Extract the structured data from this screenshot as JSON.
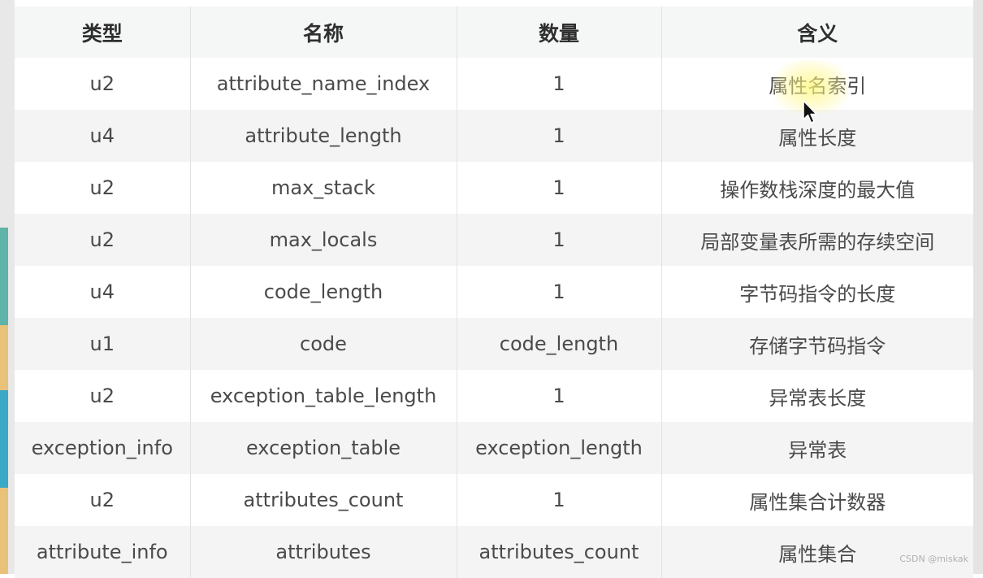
{
  "table": {
    "headers": [
      "类型",
      "名称",
      "数量",
      "含义"
    ],
    "rows": [
      [
        "u2",
        "attribute_name_index",
        "1",
        "属性名索引"
      ],
      [
        "u4",
        "attribute_length",
        "1",
        "属性长度"
      ],
      [
        "u2",
        "max_stack",
        "1",
        "操作数栈深度的最大值"
      ],
      [
        "u2",
        "max_locals",
        "1",
        "局部变量表所需的存续空间"
      ],
      [
        "u4",
        "code_length",
        "1",
        "字节码指令的长度"
      ],
      [
        "u1",
        "code",
        "code_length",
        "存储字节码指令"
      ],
      [
        "u2",
        "exception_table_length",
        "1",
        "异常表长度"
      ],
      [
        "exception_info",
        "exception_table",
        "exception_length",
        "异常表"
      ],
      [
        "u2",
        "attributes_count",
        "1",
        "属性集合计数器"
      ],
      [
        "attribute_info",
        "attributes",
        "attributes_count",
        "属性集合"
      ]
    ]
  },
  "watermark": "CSDN @miskak",
  "colors": {
    "text": "#4a4a4a",
    "header_text": "#2f2f2f",
    "row_alt": "#f4f4f4",
    "highlight": "#fff778"
  }
}
